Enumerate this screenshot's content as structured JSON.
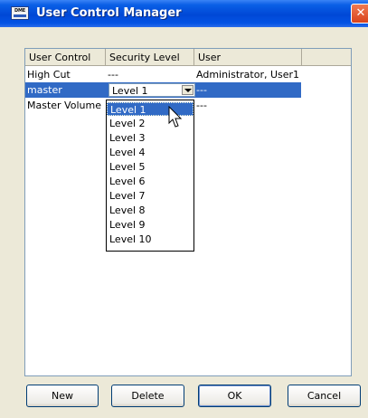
{
  "window": {
    "title": "User Control Manager",
    "app_icon_text": "DME",
    "close_symbol": "✕"
  },
  "table": {
    "columns": [
      "User Control",
      "Security Level",
      "User"
    ],
    "rows": [
      {
        "user_control": "High Cut",
        "security_level": "---",
        "user": "Administrator, User1"
      },
      {
        "user_control": "master",
        "security_level": "Level 1",
        "user": "---"
      },
      {
        "user_control": "Master Volume",
        "security_level": "",
        "user": "---"
      }
    ],
    "selected_row": 1
  },
  "dropdown": {
    "options": [
      "Level 1",
      "Level 2",
      "Level 3",
      "Level 4",
      "Level 5",
      "Level 6",
      "Level 7",
      "Level 8",
      "Level 9",
      "Level 10"
    ],
    "hovered_index": 0
  },
  "buttons": {
    "new_label": "New",
    "delete_label": "Delete",
    "ok_label": "OK",
    "cancel_label": "Cancel"
  },
  "icons": {
    "app": "dme-app-icon",
    "close": "close-icon",
    "combo": "chevron-down-icon",
    "cursor": "mouse-pointer-icon"
  },
  "colors": {
    "titlebar": "#0048d6",
    "selection": "#316ac5",
    "close_button": "#d9431b"
  }
}
